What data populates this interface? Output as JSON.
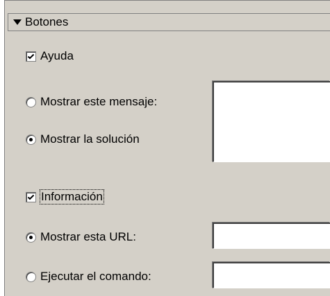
{
  "section": {
    "title": "Botones",
    "expanded": true
  },
  "help": {
    "checkbox_label": "Ayuda",
    "checked": true,
    "options": [
      {
        "label": "Mostrar este mensaje:",
        "selected": false
      },
      {
        "label": "Mostrar la solución",
        "selected": true
      }
    ],
    "message_value": ""
  },
  "info": {
    "checkbox_label": "Información",
    "checked": true,
    "options": [
      {
        "label": "Mostrar esta URL:",
        "selected": true
      },
      {
        "label": "Ejecutar el comando:",
        "selected": false
      }
    ],
    "url_value": "",
    "command_value": ""
  },
  "icons": {
    "section_toggle": "triangle-down-icon",
    "check": "checkmark-icon",
    "radio_selected": "radio-dot-icon"
  }
}
